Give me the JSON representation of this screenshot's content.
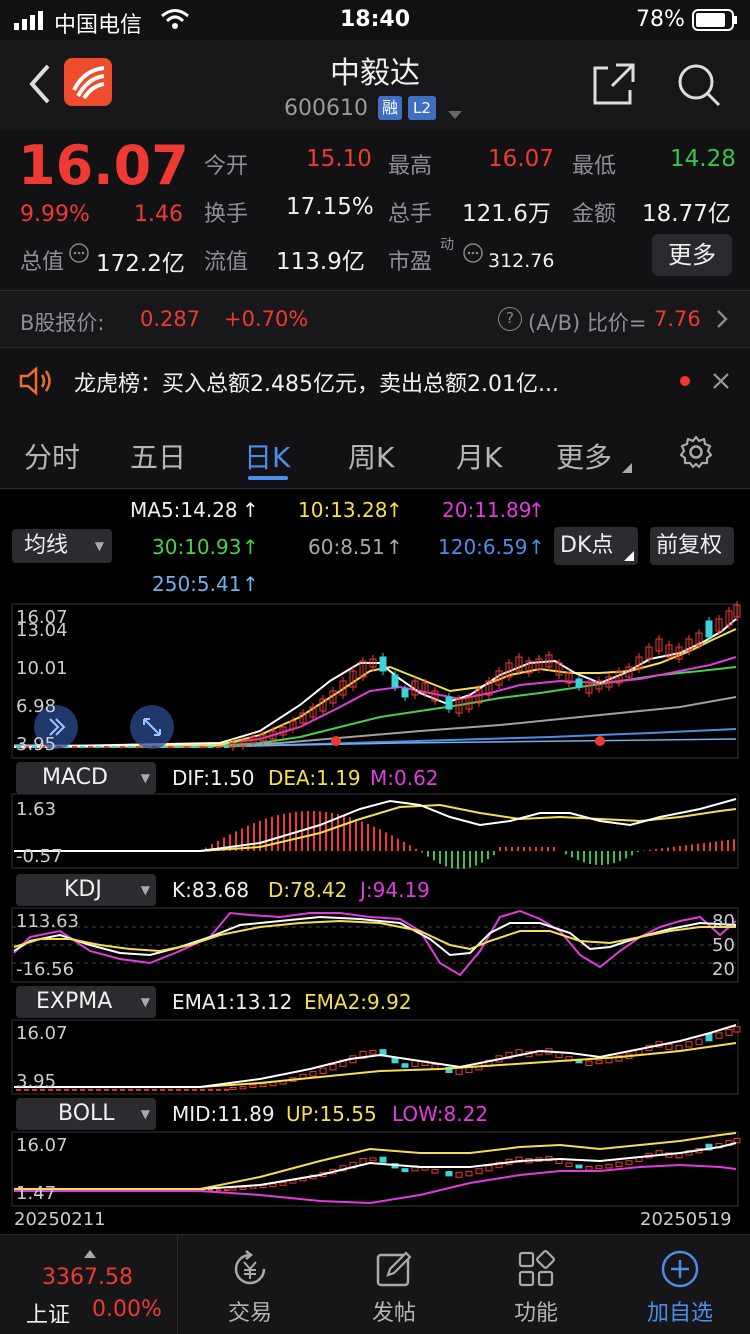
{
  "status_bar": {
    "carrier": "中国电信",
    "time": "18:40",
    "battery": "78%"
  },
  "header": {
    "name": "中毅达",
    "code": "600610",
    "badge1": "融",
    "badge2": "L2"
  },
  "quote": {
    "price": "16.07",
    "change_pct": "9.99%",
    "change": "1.46",
    "open_label": "今开",
    "open": "15.10",
    "high_label": "最高",
    "high": "16.07",
    "low_label": "最低",
    "low": "14.28",
    "turnover_label": "换手",
    "turnover": "17.15%",
    "volume_label": "总手",
    "volume": "121.6万",
    "amount_label": "金额",
    "amount": "18.77亿",
    "mktcap_label": "总值",
    "mktcap": "172.2亿",
    "float_label": "流值",
    "float": "113.9亿",
    "pe_label": "市盈",
    "pe_sup": "动",
    "pe": "312.76",
    "more": "更多"
  },
  "bshare": {
    "label": "B股报价:",
    "price": "0.287",
    "pct": "+0.70%",
    "ratio_label": "(A/B) 比价=",
    "ratio": "7.76",
    "help": "?"
  },
  "notice": {
    "text": "龙虎榜：买入总额2.485亿元，卖出总额2.01亿..."
  },
  "tabs": [
    "分时",
    "五日",
    "日K",
    "周K",
    "月K",
    "更多"
  ],
  "ma": {
    "selector": "均线",
    "ma5": "MA5:14.28",
    "ma10": "10:13.28",
    "ma20": "20:11.89",
    "ma30": "30:10.93",
    "ma60": "60:8.51",
    "ma120": "120:6.59",
    "ma250": "250:5.41",
    "dk": "DK点",
    "fq": "前复权"
  },
  "kline": {
    "y1": "16.07",
    "y2": "13.04",
    "y3": "10.01",
    "y4": "6.98",
    "y5": "3.95"
  },
  "macd": {
    "selector": "MACD",
    "dif": "DIF:1.50",
    "dea": "DEA:1.19",
    "m": "M:0.62",
    "y1": "1.63",
    "y2": "-0.57"
  },
  "kdj": {
    "selector": "KDJ",
    "k": "K:83.68",
    "d": "D:78.42",
    "j": "J:94.19",
    "y1": "113.63",
    "y2": "-16.56",
    "r80": "80",
    "r50": "50",
    "r20": "20"
  },
  "expma": {
    "selector": "EXPMA",
    "ema1": "EMA1:13.12",
    "ema2": "EMA2:9.92",
    "y1": "16.07",
    "y2": "3.95"
  },
  "boll": {
    "selector": "BOLL",
    "mid": "MID:11.89",
    "up": "UP:15.55",
    "low": "LOW:8.22",
    "y1": "16.07",
    "y2": "1.47"
  },
  "dates": {
    "start": "20250211",
    "end": "20250519"
  },
  "bottom": {
    "index_value": "3367.58",
    "index_name": "上证",
    "index_pct": "0.00%",
    "trade": "交易",
    "post": "发帖",
    "func": "功能",
    "watch": "加自选"
  }
}
